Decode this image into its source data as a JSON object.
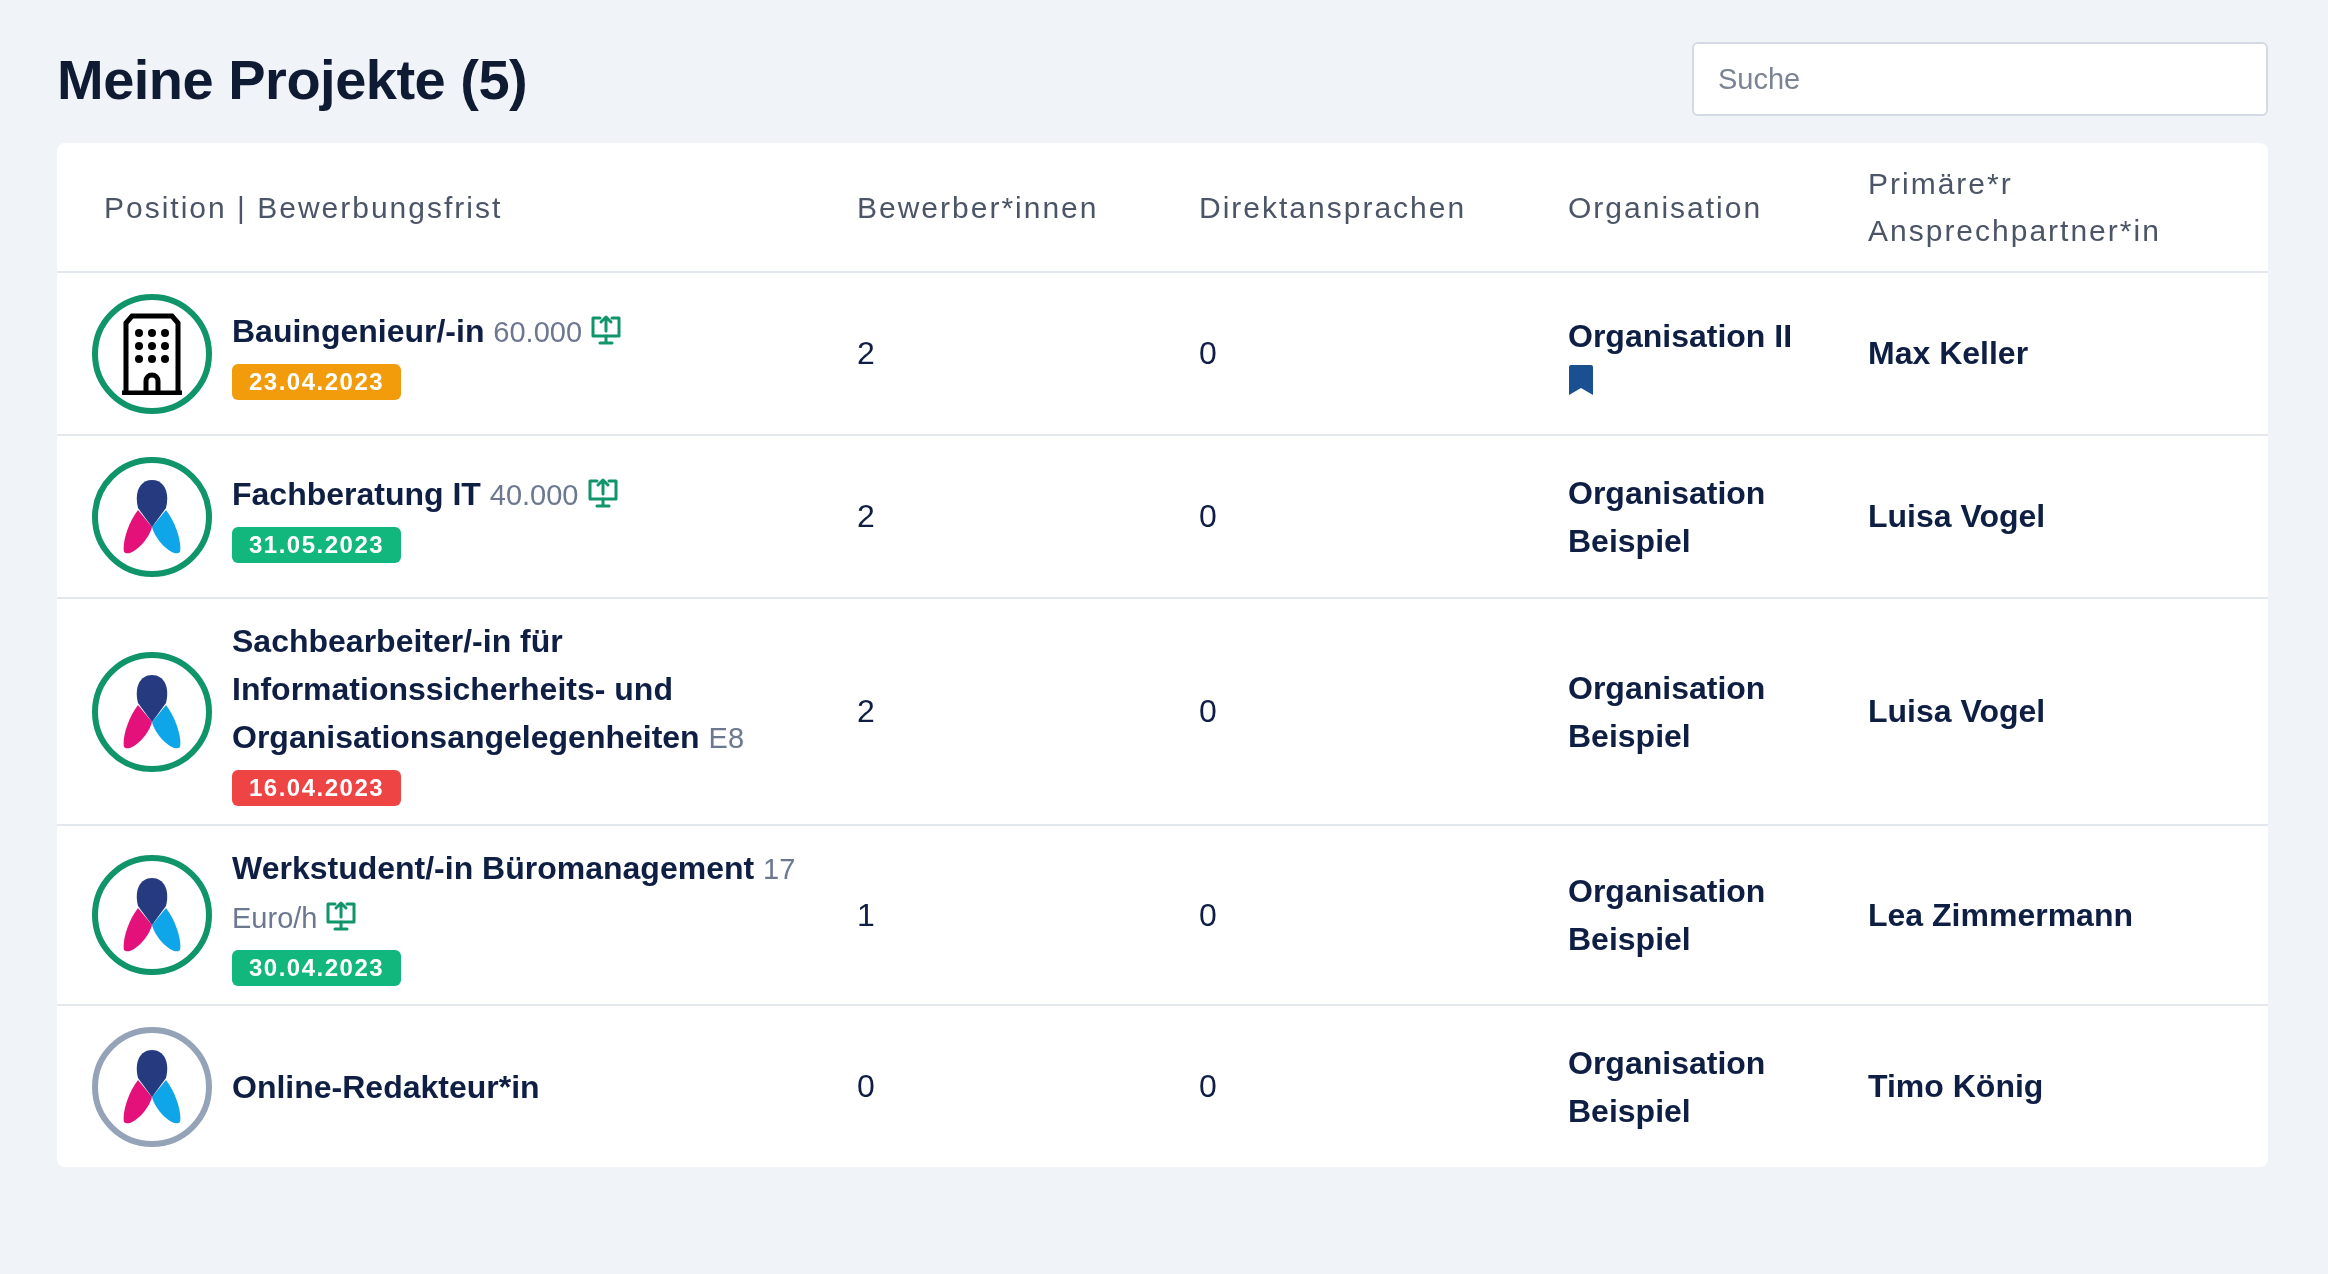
{
  "title": "Meine Projekte (5)",
  "search": {
    "placeholder": "Suche"
  },
  "table": {
    "columns": [
      "Position | Bewerbungsfrist",
      "Bewerber*innen",
      "Direktansprachen",
      "Organisation",
      "Primäre*r Ansprechpartner*in"
    ],
    "rows": [
      {
        "logo": {
          "kind": "building",
          "color": "#10946a"
        },
        "position": "Bauingenieur/-in",
        "salary": "60.000",
        "monitor_icon": true,
        "deadline": {
          "text": "23.04.2023",
          "color": "#f39c0b"
        },
        "applicants": "2",
        "direct": "0",
        "organisation": "Organisation II",
        "bookmarked": true,
        "contact": "Max Keller"
      },
      {
        "logo": {
          "kind": "brand",
          "color": "#10946a"
        },
        "position": "Fachberatung IT",
        "salary": "40.000",
        "monitor_icon": true,
        "deadline": {
          "text": "31.05.2023",
          "color": "#12b77d"
        },
        "applicants": "2",
        "direct": "0",
        "organisation": "Organisation Beispiel",
        "bookmarked": false,
        "contact": "Luisa Vogel"
      },
      {
        "logo": {
          "kind": "brand",
          "color": "#10946a"
        },
        "position": "Sachbearbeiter/-in für Informationssicherheits- und Organisationsangelegenheiten",
        "salary": "E8",
        "monitor_icon": false,
        "deadline": {
          "text": "16.04.2023",
          "color": "#ef4444"
        },
        "applicants": "2",
        "direct": "0",
        "organisation": "Organisation Beispiel",
        "bookmarked": false,
        "contact": "Luisa Vogel"
      },
      {
        "logo": {
          "kind": "brand",
          "color": "#10946a"
        },
        "position": "Werkstudent/-in Büromanagement",
        "salary": "17 Euro/h",
        "monitor_icon": true,
        "deadline": {
          "text": "30.04.2023",
          "color": "#12b77d"
        },
        "applicants": "1",
        "direct": "0",
        "organisation": "Organisation Beispiel",
        "bookmarked": false,
        "contact": "Lea Zimmermann"
      },
      {
        "logo": {
          "kind": "brand",
          "color": "#94a3b8"
        },
        "position": "Online-Redakteur*in",
        "applicants": "0",
        "direct": "0",
        "organisation": "Organisation Beispiel",
        "bookmarked": false,
        "contact": "Timo König"
      }
    ]
  }
}
